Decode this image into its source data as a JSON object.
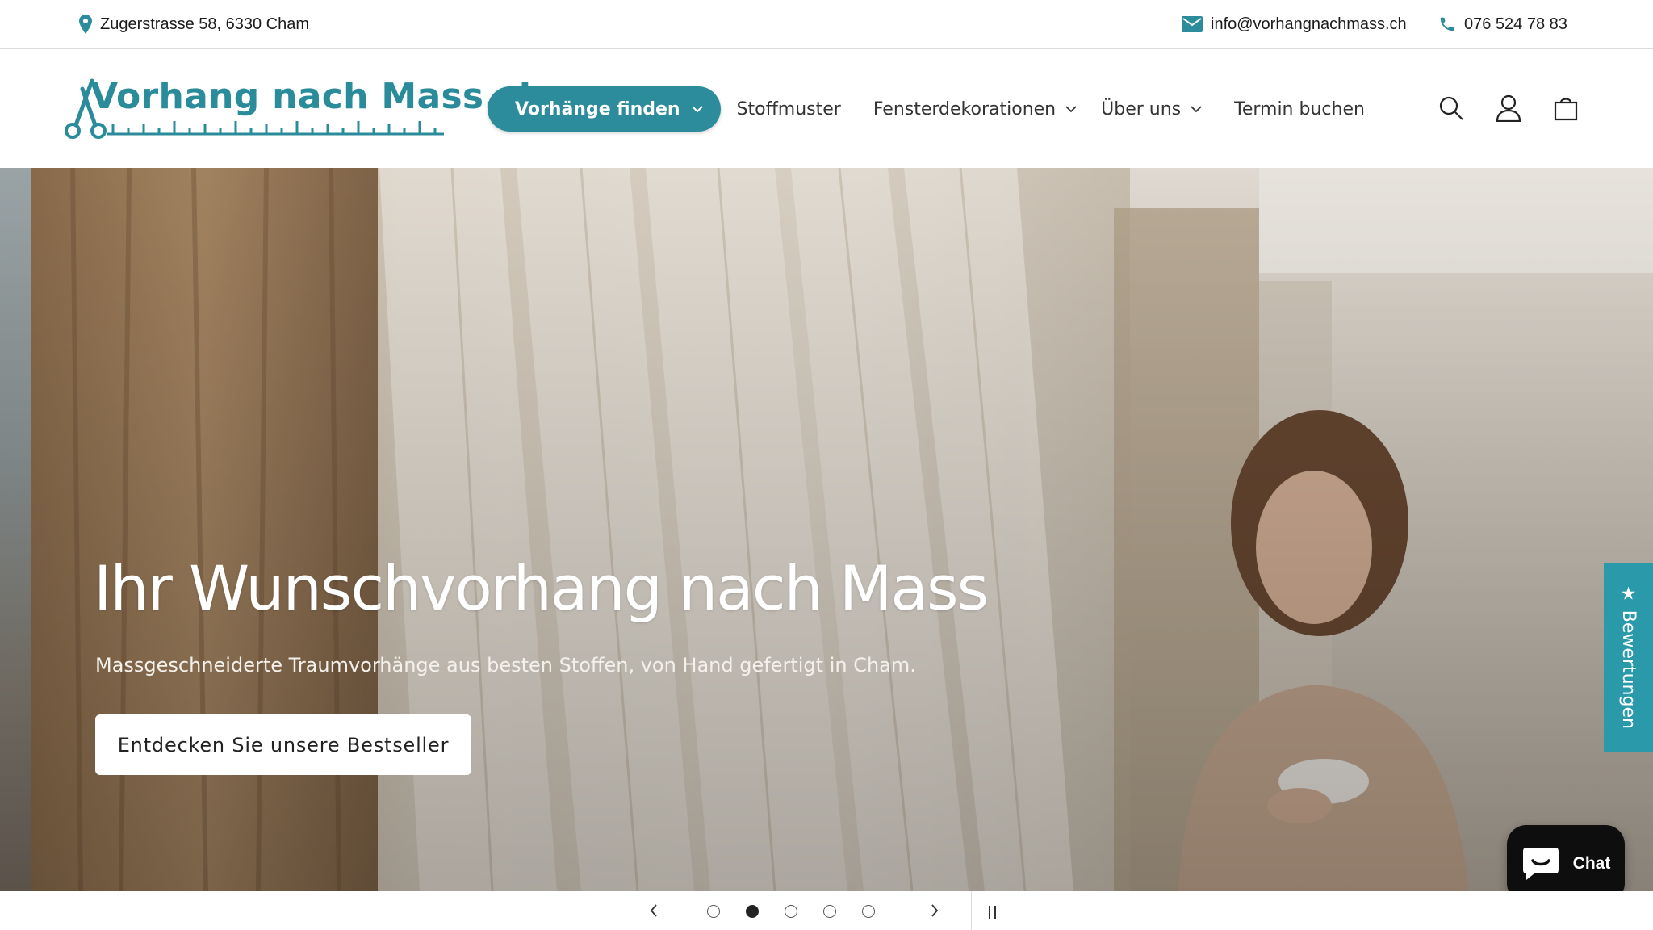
{
  "topbar": {
    "address": "Zugerstrasse 58, 6330 Cham",
    "email": "info@vorhangnachmass.ch",
    "phone": "076 524 78 83",
    "icons": [
      "location-pin-icon",
      "mail-icon",
      "phone-icon"
    ]
  },
  "header": {
    "logo_text": "Vorhang nach Mass.ch",
    "nav": {
      "primary": "Vorhänge finden",
      "items": [
        "Stoffmuster",
        "Fensterdekorationen",
        "Über uns",
        "Termin buchen"
      ]
    },
    "icons": [
      "search-icon",
      "account-icon",
      "cart-icon"
    ]
  },
  "hero": {
    "title": "Ihr Wunschvorhang nach Mass",
    "subtitle": "Massgeschneiderte Traumvorhänge aus besten Stoffen, von Hand gefertigt in Cham.",
    "cta": "Entdecken Sie unsere Bestseller"
  },
  "widgets": {
    "reviews": "Bewertungen",
    "chat": "Chat"
  },
  "slider": {
    "slide_count": 5,
    "active_slide": 2
  },
  "colors": {
    "brand": "#2d8c9c",
    "reviews_tab": "#2a9aab",
    "chat": "#0e0e0e"
  }
}
